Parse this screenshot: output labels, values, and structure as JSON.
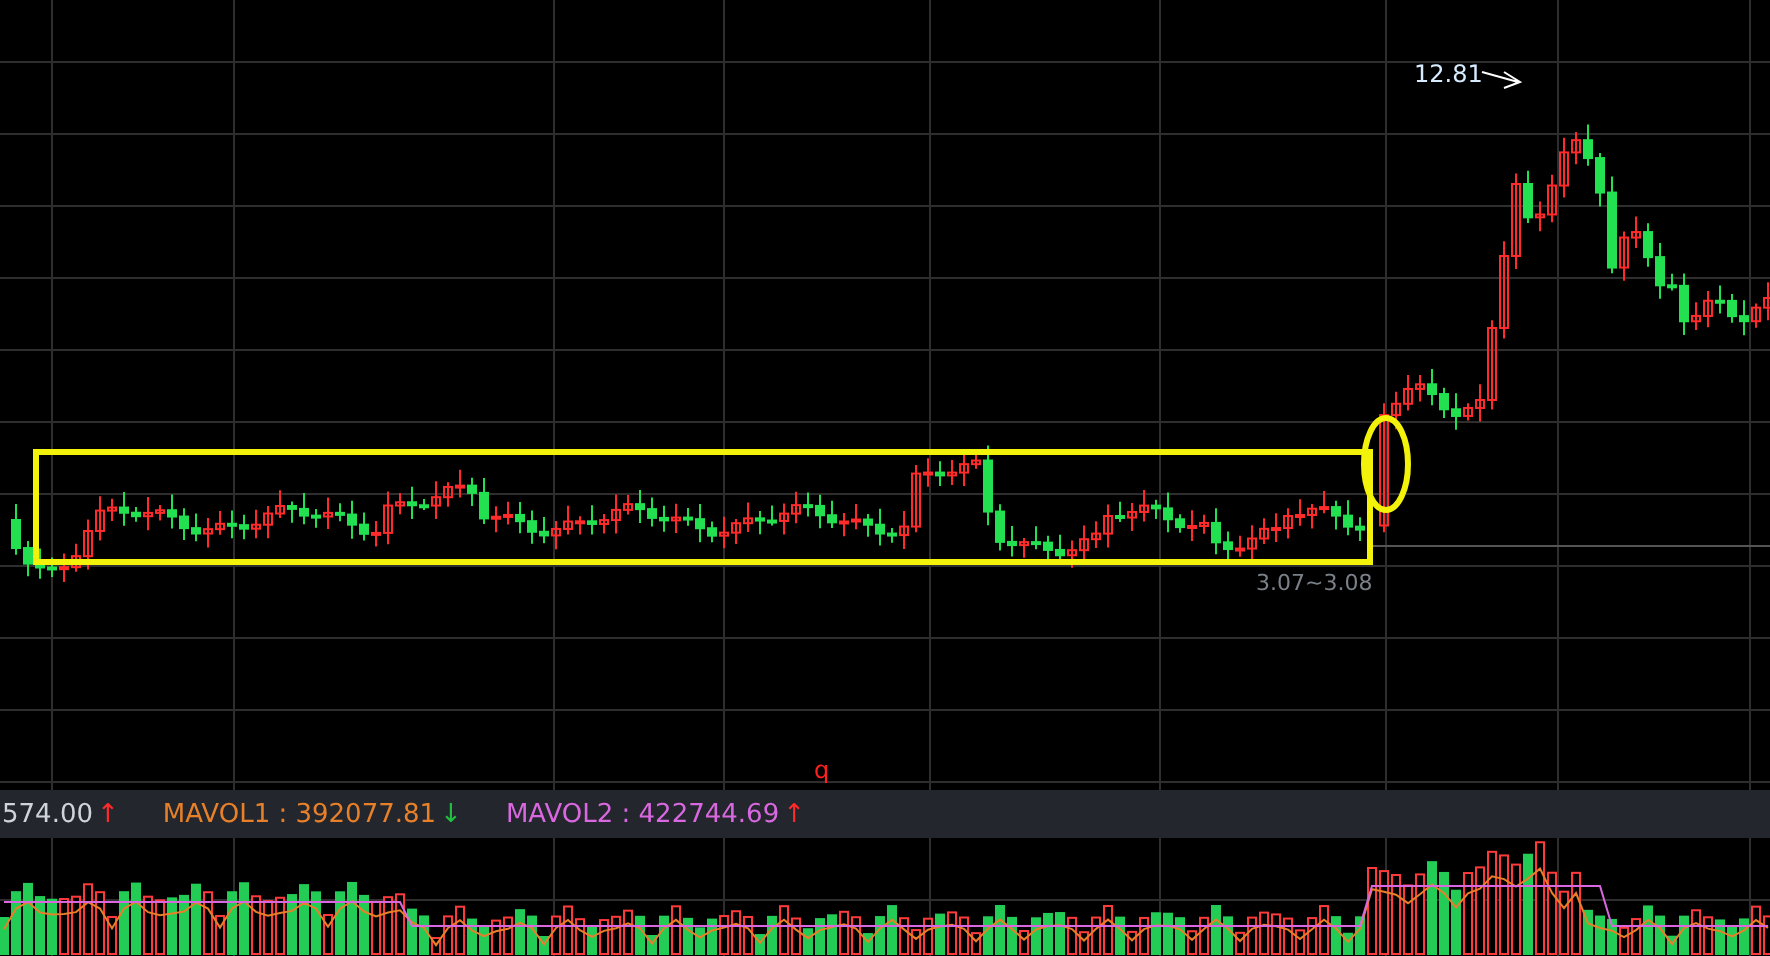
{
  "price_chart": {
    "high_label": "12.81",
    "range_label": "3.07~3.08",
    "marker": "q"
  },
  "indicator_bar": {
    "items": [
      {
        "value": "574.00",
        "color": "#cfd3da",
        "arrow": {
          "text": "↑",
          "color": "#ff2a2a"
        }
      },
      {
        "value": "MAVOL1 : 392077.81",
        "color": "#e8802a",
        "arrow": {
          "text": "↓",
          "color": "#20c040"
        }
      },
      {
        "value": "MAVOL2 : 422744.69",
        "color": "#d968e0",
        "arrow": {
          "text": "↑",
          "color": "#ff2a2a"
        }
      }
    ]
  }
}
